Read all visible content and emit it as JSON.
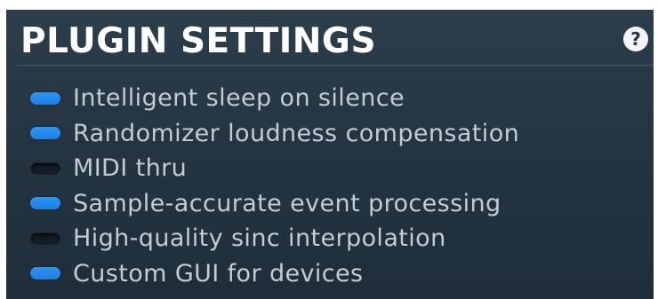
{
  "panel": {
    "title": "PLUGIN SETTINGS",
    "help_glyph": "?",
    "help_icon": "question-mark-icon"
  },
  "colors": {
    "panel_background": "#233340",
    "toggle_on": "#1d80e3",
    "toggle_off": "#0f161c",
    "text": "#c3ccd3"
  },
  "options": [
    {
      "label": "Intelligent sleep on silence",
      "enabled": true
    },
    {
      "label": "Randomizer loudness compensation",
      "enabled": true
    },
    {
      "label": "MIDI thru",
      "enabled": false
    },
    {
      "label": "Sample-accurate event processing",
      "enabled": true
    },
    {
      "label": "High-quality sinc interpolation",
      "enabled": false
    },
    {
      "label": "Custom GUI for devices",
      "enabled": true
    }
  ]
}
